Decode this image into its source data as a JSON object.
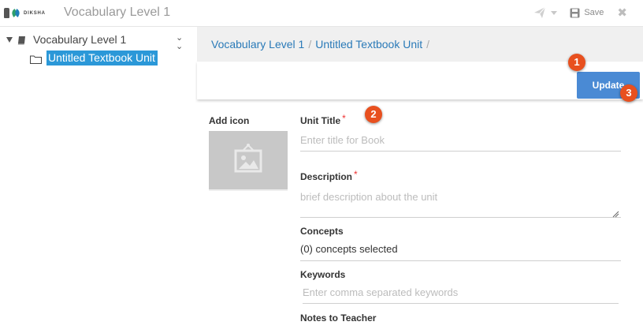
{
  "app": {
    "brand": "DIKSHA",
    "title": "Vocabulary Level 1",
    "save_label": "Save"
  },
  "sidebar": {
    "root_label": "Vocabulary Level 1",
    "child_label": "Untitled Textbook Unit"
  },
  "breadcrumb": {
    "items": [
      "Vocabulary Level 1",
      "Untitled Textbook Unit"
    ],
    "separator": "/"
  },
  "header": {
    "update_label": "Update"
  },
  "badges": [
    "1",
    "2",
    "3"
  ],
  "icon_picker": {
    "label": "Add icon"
  },
  "form": {
    "unit_title": {
      "label": "Unit Title",
      "required": "*",
      "placeholder": "Enter title for Book"
    },
    "description": {
      "label": "Description",
      "required": "*",
      "placeholder": "brief description about the unit"
    },
    "concepts": {
      "label": "Concepts",
      "value": "(0) concepts selected"
    },
    "keywords": {
      "label": "Keywords",
      "placeholder": "Enter comma separated keywords"
    },
    "notes": {
      "label": "Notes to Teacher"
    }
  },
  "colors": {
    "accent": "#2b98d8",
    "link": "#2a7ab8",
    "update_button": "#4a8ad4",
    "badge": "#e8501f",
    "required": "#ee3333"
  },
  "icons": [
    "send-icon",
    "caret-down-icon",
    "save-icon",
    "close-icon",
    "expand-triangle-icon",
    "book-icon",
    "collapse-chevrons-icon",
    "folder-icon",
    "image-placeholder-icon",
    "resize-handle-icon"
  ]
}
